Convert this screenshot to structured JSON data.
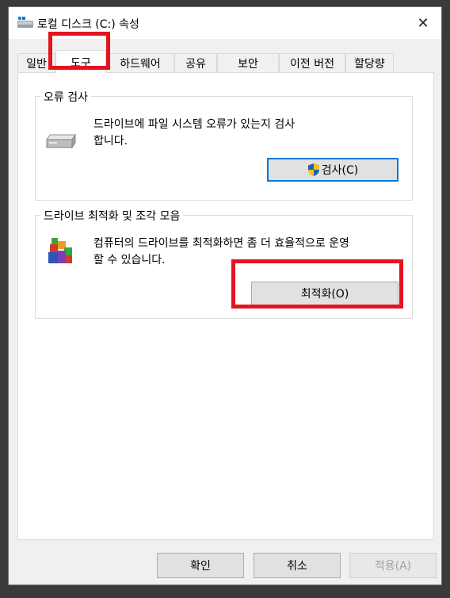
{
  "window": {
    "title": "로컬 디스크 (C:) 속성",
    "close_glyph": "✕"
  },
  "tabs": [
    {
      "label": "일반"
    },
    {
      "label": "도구",
      "active": true
    },
    {
      "label": "하드웨어"
    },
    {
      "label": "공유"
    },
    {
      "label": "보안"
    },
    {
      "label": "이전 버전"
    },
    {
      "label": "할당량"
    }
  ],
  "error_check": {
    "group_label": "오류 검사",
    "description_line1": "드라이브에 파일 시스템 오류가 있는지 검사",
    "description_line2": "합니다.",
    "button_label": "검사(C)"
  },
  "optimize": {
    "group_label": "드라이브 최적화 및 조각 모음",
    "description_line1": "컴퓨터의 드라이브를 최적화하면 좀 더 효율적으로 운영",
    "description_line2": "할 수 있습니다.",
    "button_label": "최적화(O)"
  },
  "footer": {
    "ok_label": "확인",
    "cancel_label": "취소",
    "apply_label": "적용(A)"
  },
  "colors": {
    "highlight": "#e4141f",
    "focus_border": "#0078d7",
    "shield_blue": "#1e5fb4",
    "shield_yellow": "#f4c21a"
  }
}
